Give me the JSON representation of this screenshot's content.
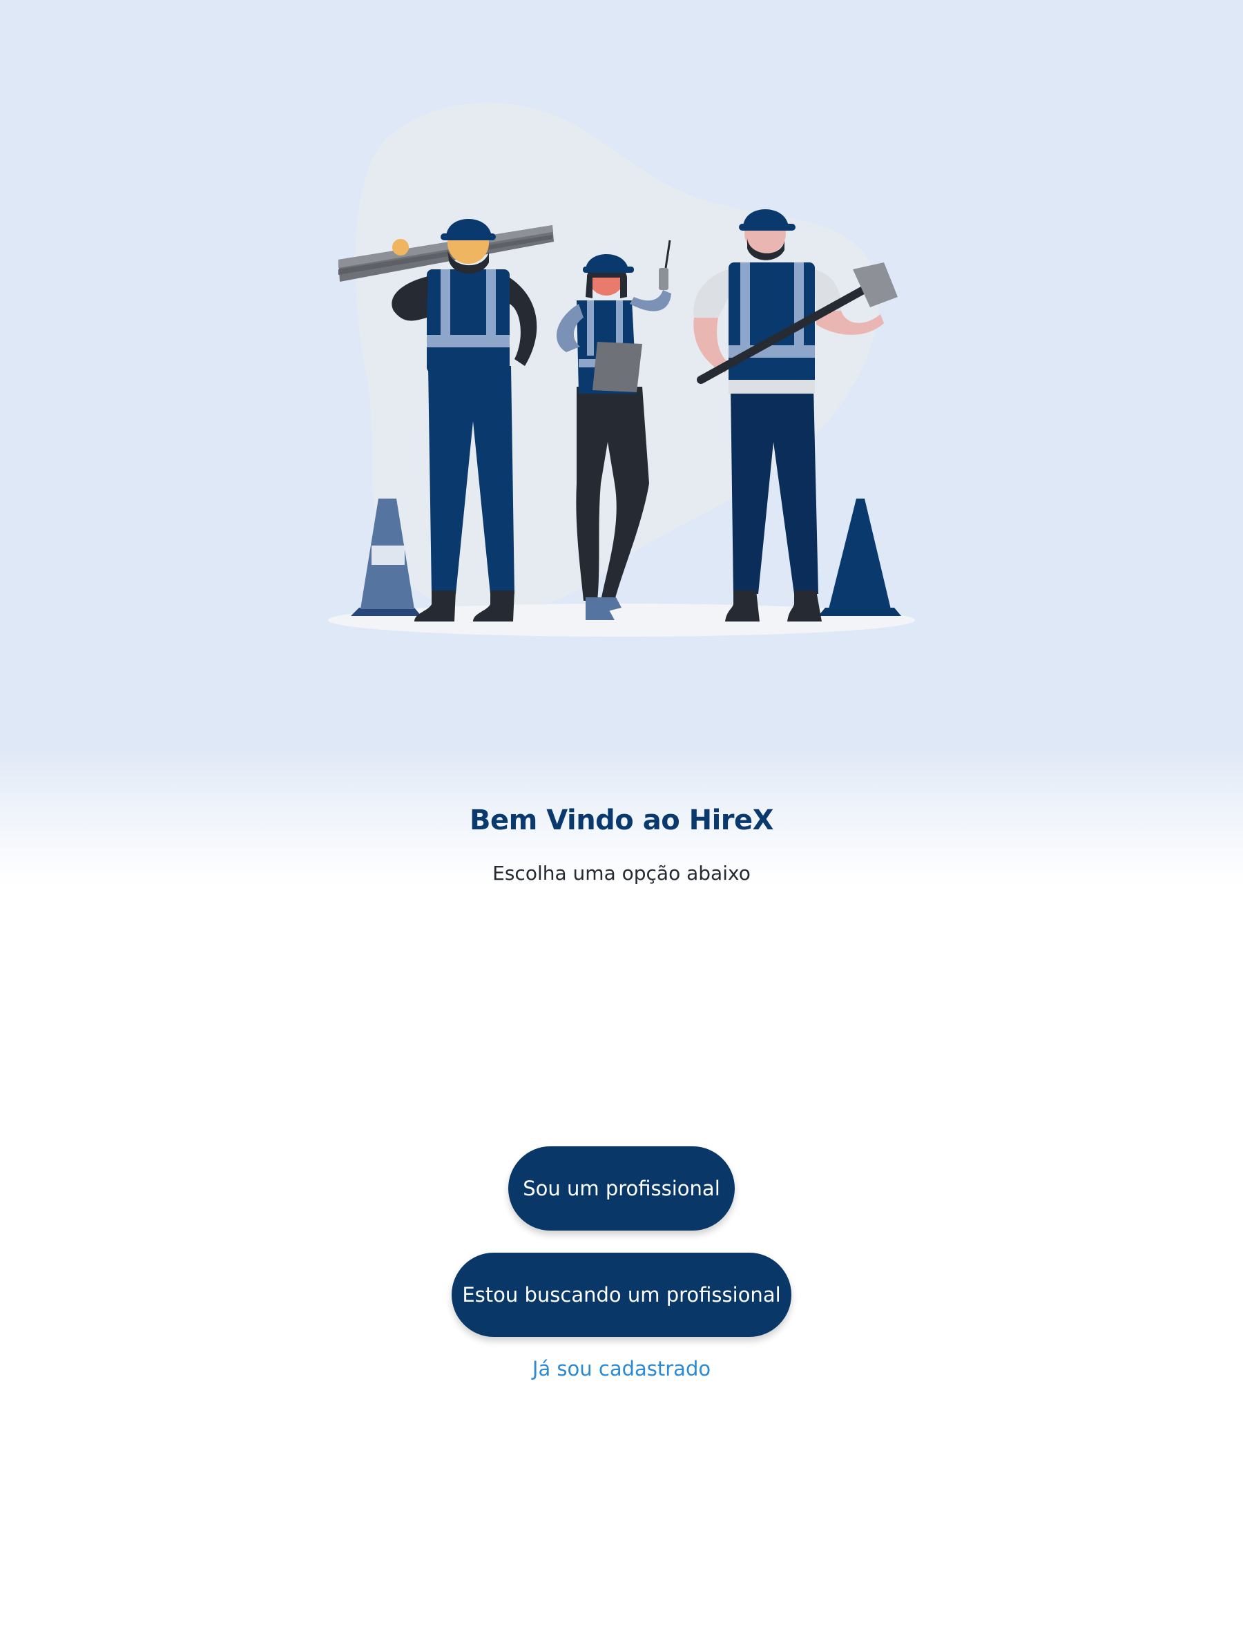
{
  "hero": {
    "illustration": "construction-workers-illustration",
    "background_color": "#dfe8f6"
  },
  "welcome": {
    "title": "Bem Vindo ao HireX",
    "subtitle": "Escolha uma opção abaixo"
  },
  "actions": {
    "professional_label": "Sou um profissional",
    "seeking_label": "Estou buscando um profissional",
    "login_label": "Já sou cadastrado"
  },
  "colors": {
    "primary": "#083768",
    "title": "#0a3a6d",
    "link": "#2a8ad6"
  }
}
